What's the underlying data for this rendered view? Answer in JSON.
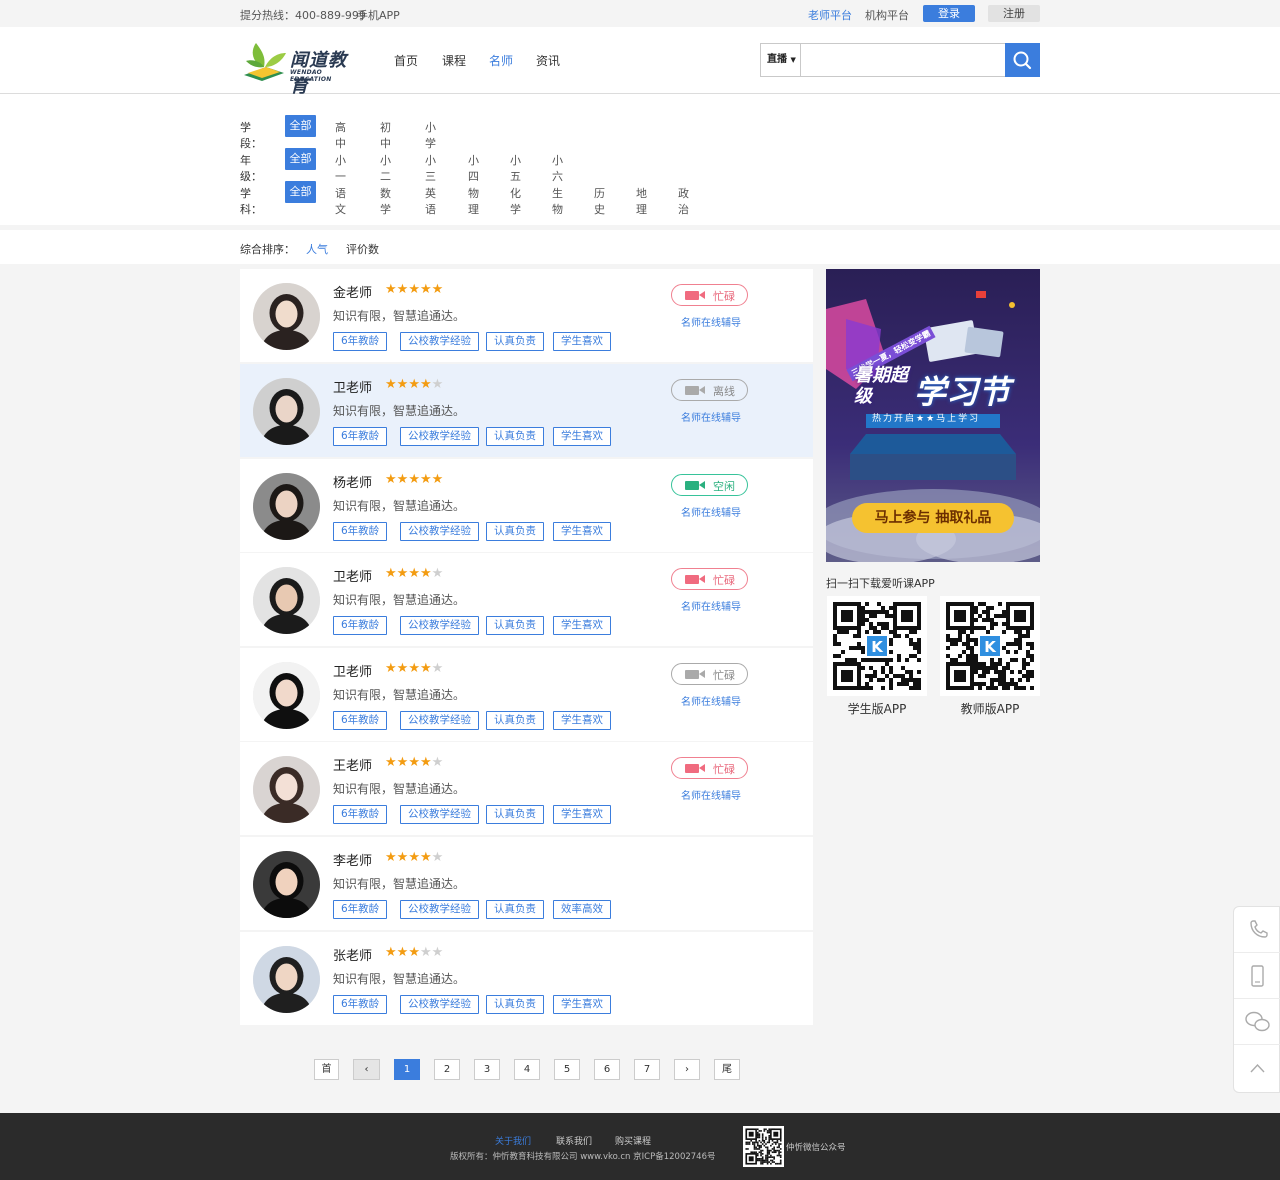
{
  "topbar": {
    "hotline": "提分热线：400-889-999",
    "mobile_app": "手机APP",
    "teacher_platform": "老师平台",
    "org_platform": "机构平台",
    "login": "登录",
    "register": "注册"
  },
  "header": {
    "logo_text": "闻道教育",
    "logo_sub": "WENDAO EDUCATION",
    "nav": [
      "首页",
      "课程",
      "名师",
      "资讯"
    ],
    "nav_active_index": 2,
    "search": {
      "type": "直播",
      "placeholder": "",
      "value": ""
    }
  },
  "filters": {
    "stage": {
      "label": "学段：",
      "selected": "全部",
      "items": [
        "高中",
        "初中",
        "小学"
      ]
    },
    "grade": {
      "label": "年级：",
      "selected": "全部",
      "items": [
        "小一",
        "小二",
        "小三",
        "小四",
        "小五",
        "小六"
      ]
    },
    "subject": {
      "label": "学科：",
      "selected": "全部",
      "items": [
        "语文",
        "数学",
        "英语",
        "物理",
        "化学",
        "生物",
        "历史",
        "地理",
        "政治"
      ]
    }
  },
  "sort": {
    "label": "综合排序：",
    "items": [
      "人气",
      "评价数"
    ],
    "active_index": 0
  },
  "teachers": [
    {
      "name": "金老师",
      "stars": 5,
      "desc": "知识有限，智慧追通达。",
      "tags": [
        "6年教龄",
        "公校教学经验",
        "认真负责",
        "学生喜欢"
      ],
      "status": "忙碌",
      "status_type": "busy",
      "link": "名师在线辅导",
      "highlight": false
    },
    {
      "name": "卫老师",
      "stars": 4,
      "desc": "知识有限，智慧追通达。",
      "tags": [
        "6年教龄",
        "公校教学经验",
        "认真负责",
        "学生喜欢"
      ],
      "status": "离线",
      "status_type": "off",
      "link": "名师在线辅导",
      "highlight": true
    },
    {
      "name": "杨老师",
      "stars": 5,
      "desc": "知识有限，智慧追通达。",
      "tags": [
        "6年教龄",
        "公校教学经验",
        "认真负责",
        "学生喜欢"
      ],
      "status": "空闲",
      "status_type": "free",
      "link": "名师在线辅导",
      "highlight": false
    },
    {
      "name": "卫老师",
      "stars": 4,
      "desc": "知识有限，智慧追通达。",
      "tags": [
        "6年教龄",
        "公校教学经验",
        "认真负责",
        "学生喜欢"
      ],
      "status": "忙碌",
      "status_type": "busy",
      "link": "名师在线辅导",
      "highlight": false
    },
    {
      "name": "卫老师",
      "stars": 4,
      "desc": "知识有限，智慧追通达。",
      "tags": [
        "6年教龄",
        "公校教学经验",
        "认真负责",
        "学生喜欢"
      ],
      "status": "忙碌",
      "status_type": "off",
      "link": "名师在线辅导",
      "highlight": false
    },
    {
      "name": "王老师",
      "stars": 4,
      "desc": "知识有限，智慧追通达。",
      "tags": [
        "6年教龄",
        "公校教学经验",
        "认真负责",
        "学生喜欢"
      ],
      "status": "忙碌",
      "status_type": "busy",
      "link": "名师在线辅导",
      "highlight": false
    },
    {
      "name": "李老师",
      "stars": 4,
      "desc": "知识有限，智慧追通达。",
      "tags": [
        "6年教龄",
        "公校教学经验",
        "认真负责",
        "效率高效"
      ],
      "status": "",
      "status_type": "",
      "link": "",
      "highlight": false
    },
    {
      "name": "张老师",
      "stars": 3,
      "desc": "知识有限，智慧追通达。",
      "tags": [
        "6年教龄",
        "公校教学经验",
        "认真负责",
        "学生喜欢"
      ],
      "status": "",
      "status_type": "",
      "link": "",
      "highlight": false
    }
  ],
  "banner": {
    "kicker": "三伏学一夏，轻松变学霸",
    "title_left": "暑期超级",
    "title_right": "学习节",
    "strip": "热力开启★★马上学习",
    "cta": "马上参与 抽取礼品"
  },
  "app_download": {
    "title": "扫一扫下载爱听课APP",
    "student": "学生版APP",
    "teacher": "教师版APP"
  },
  "pagination": {
    "first": "首",
    "last": "尾",
    "pages": [
      "1",
      "2",
      "3",
      "4",
      "5",
      "6",
      "7"
    ],
    "current": "1"
  },
  "side_tools": [
    "phone-icon",
    "mobile-icon",
    "wechat-icon",
    "back-to-top-icon"
  ],
  "footer": {
    "links": [
      "关于我们",
      "联系我们",
      "购买课程"
    ],
    "copyright": "版权所有：仲忻教育科技有限公司 www.vko.cn 京ICP备12002746号",
    "wechat": "仲忻微信公众号"
  },
  "colors": {
    "accent": "#3b7ddd",
    "star": "#f39c12",
    "busy": "#e8667a",
    "free": "#2ab07f",
    "offline": "#888888"
  }
}
